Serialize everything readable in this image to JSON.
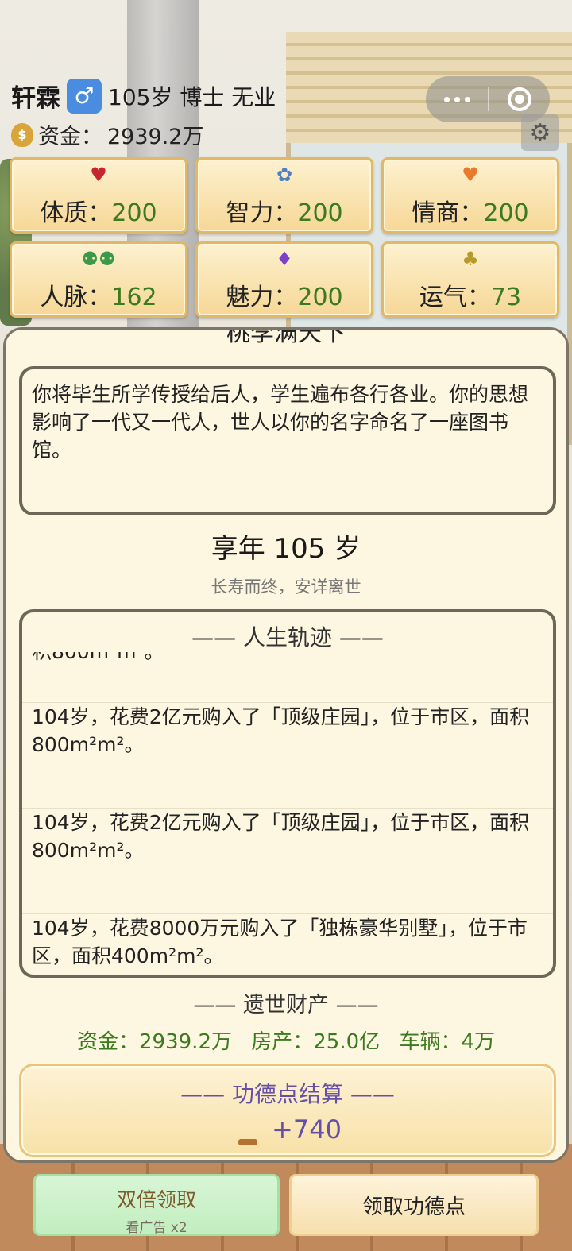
{
  "header": {
    "name": "轩霖",
    "gender_symbol": "♂",
    "info": "105岁 博士 无业",
    "funds_label": "资金：",
    "funds_value": "2939.2万"
  },
  "stats": [
    {
      "label": "体质：",
      "value": "200",
      "icon": "heart-icon",
      "glyph": "♥",
      "color": "#c8242f"
    },
    {
      "label": "智力：",
      "value": "200",
      "icon": "brain-icon",
      "glyph": "🧠",
      "color": "#4f7fc7"
    },
    {
      "label": "情商：",
      "value": "200",
      "icon": "smile-heart-icon",
      "glyph": "♥",
      "color": "#ea7a2b"
    },
    {
      "label": "人脉：",
      "value": "162",
      "icon": "people-icon",
      "glyph": "👫",
      "color": "#3b9a4a"
    },
    {
      "label": "魅力：",
      "value": "200",
      "icon": "diamond-icon",
      "glyph": "♦",
      "color": "#7b3fc8"
    },
    {
      "label": "运气：",
      "value": "73",
      "icon": "clover-icon",
      "glyph": "♣",
      "color": "#b79a2c"
    }
  ],
  "panel": {
    "head_partial": "桃李满天下",
    "story": "你将毕生所学传授给后人，学生遍布各行各业。你的思想影响了一代又一代人，世人以你的名字命名了一座图书馆。",
    "age_title": "享年 105 岁",
    "age_sub": "长寿而终，安详离世",
    "trajectory_title": "—— 人生轨迹 ——",
    "trajectory": [
      "积800m²m²。",
      "104岁，花费2亿元购入了「顶级庄园」，位于市区，面积800m²m²。",
      "104岁，花费2亿元购入了「顶级庄园」，位于市区，面积800m²m²。",
      "104岁，花费8000万元购入了「独栋豪华别墅」，位于市区，面积400m²m²。"
    ],
    "legacy_title": "—— 遗世财产 ——",
    "legacy": {
      "funds": "资金：2939.2万",
      "property": "房产：25.0亿",
      "vehicles": "车辆：4万"
    },
    "merit_title": "—— 功德点结算 ——",
    "merit_value": "+740"
  },
  "buttons": {
    "double_main": "双倍领取",
    "double_sub": "看广告 x2",
    "claim": "领取功德点"
  }
}
